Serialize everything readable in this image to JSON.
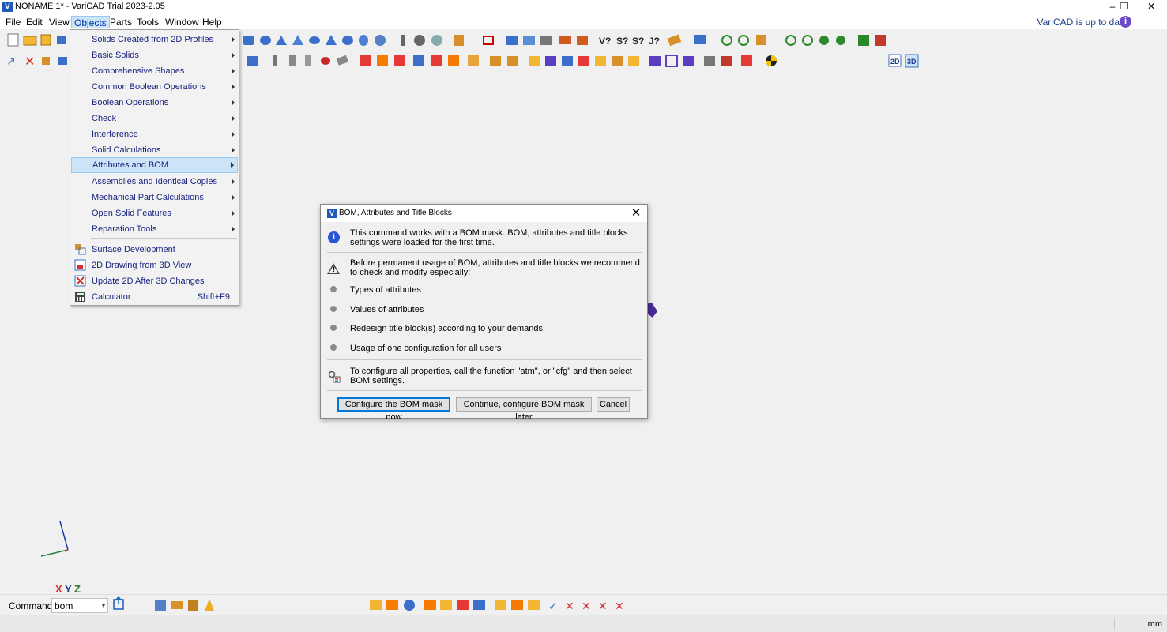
{
  "window": {
    "title": "NONAME 1* - VariCAD Trial 2023-2.05",
    "logo_glyph": "V",
    "minimize_glyph": "–",
    "restore_glyph": "❐",
    "close_glyph": "✕"
  },
  "menubar": {
    "items": [
      "File",
      "Edit",
      "View",
      "Objects",
      "Parts",
      "Tools",
      "Window",
      "Help"
    ],
    "active": "Objects",
    "update_status": "VariCAD is up to date",
    "info_glyph": "i"
  },
  "objects_menu": {
    "items": [
      {
        "label": "Solids Created from 2D Profiles",
        "submenu": true
      },
      {
        "label": "Basic Solids",
        "submenu": true
      },
      {
        "label": "Comprehensive Shapes",
        "submenu": true
      },
      {
        "label": "Common Boolean Operations",
        "submenu": true
      },
      {
        "label": "Boolean Operations",
        "submenu": true
      },
      {
        "label": "Check",
        "submenu": true
      },
      {
        "label": "Interference",
        "submenu": true
      },
      {
        "label": "Solid Calculations",
        "submenu": true
      },
      {
        "label": "Attributes and BOM",
        "submenu": true,
        "highlighted": true
      },
      {
        "label": "Assemblies and Identical Copies",
        "submenu": true
      },
      {
        "label": "Mechanical Part Calculations",
        "submenu": true
      },
      {
        "label": "Open Solid Features",
        "submenu": true
      },
      {
        "label": "Reparation Tools",
        "submenu": true
      }
    ],
    "items_with_icons": [
      {
        "label": "Surface Development",
        "icon": "surface-development-icon"
      },
      {
        "label": "2D Drawing from 3D View",
        "icon": "drawing-from-3d-icon"
      },
      {
        "label": "Update 2D After 3D Changes",
        "icon": "update-2d-icon"
      },
      {
        "label": "Calculator",
        "icon": "calculator-icon",
        "shortcut": "Shift+F9"
      }
    ]
  },
  "dialog": {
    "title": "BOM, Attributes and Title Blocks",
    "close_glyph": "✕",
    "info_text": "This command works with a BOM mask. BOM, attributes and title blocks settings were loaded for the first time.",
    "warning_text": "Before permanent usage of BOM, attributes and title blocks we recommend to check and modify especially:",
    "bullets": [
      "Types of attributes",
      "Values of attributes",
      "Redesign title block(s) according to your demands",
      "Usage of one configuration for all users"
    ],
    "config_text": "To configure all properties, call the function \"atm\", or \"cfg\" and then select BOM settings.",
    "buttons": {
      "configure_now": "Configure the BOM mask now",
      "configure_later": "Continue, configure BOM mask later",
      "cancel": "Cancel"
    }
  },
  "axes": {
    "x": "X",
    "y": "Y",
    "z": "Z",
    "x_color": "#d32f2f",
    "y_color": "#1a3c8c",
    "z_color": "#2e7d32"
  },
  "command_bar": {
    "label": "Command:",
    "value": "bom"
  },
  "status_bar": {
    "units": "mm"
  },
  "colors": {
    "accent": "#0078d7",
    "menu_highlight": "#cce4f7",
    "menu_text": "#1a237e"
  }
}
